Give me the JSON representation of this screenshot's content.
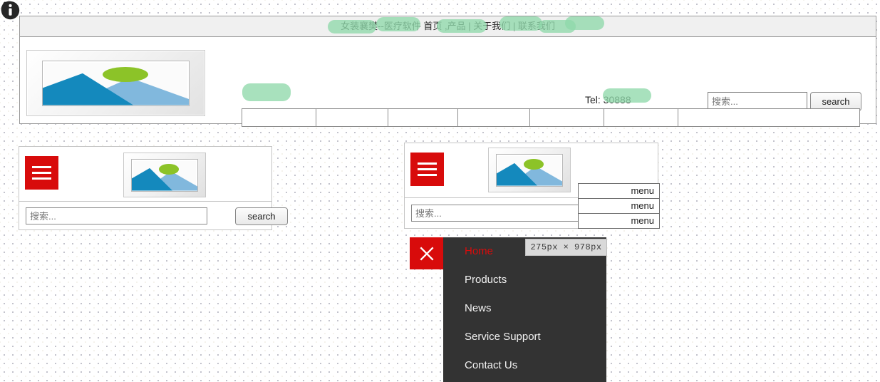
{
  "desktop_header": {
    "topbar": {
      "text": "女装襄樊--医疗软件 首页 ,产品 | 关于我们 | 联系我们",
      "redacted": true
    },
    "logo_alt": "broken-image-placeholder",
    "tel": "Tel: 30888",
    "search": {
      "placeholder": "搜索...",
      "value": "",
      "button_label": "search"
    },
    "nav_table": {
      "cells": [
        "",
        "",
        "",
        "",
        "",
        "",
        ""
      ],
      "first_cell_redacted": true
    }
  },
  "card_a": {
    "menu_icon": "hamburger-icon",
    "logo_alt": "broken-image-placeholder",
    "phone_icon": "phone-icon",
    "info_icon": "info-icon",
    "search": {
      "placeholder": "搜索...",
      "value": "",
      "button_label": "search"
    }
  },
  "card_b": {
    "menu_icon": "hamburger-icon",
    "logo_alt": "broken-image-placeholder",
    "phone_icon": "phone-icon",
    "info_icon": "info-icon",
    "search": {
      "placeholder": "搜索...",
      "value": ""
    },
    "dropdown": {
      "items": [
        "menu",
        "menu",
        "menu"
      ]
    }
  },
  "panel": {
    "close_icon": "close-icon",
    "accent_color": "#d80b0b",
    "background_color": "#333333",
    "items": [
      {
        "label": "Home",
        "active": true
      },
      {
        "label": "Products",
        "active": false
      },
      {
        "label": "News",
        "active": false
      },
      {
        "label": "Service Support",
        "active": false
      },
      {
        "label": "Contact Us",
        "active": false
      }
    ],
    "size_tooltip": "275px × 978px"
  }
}
